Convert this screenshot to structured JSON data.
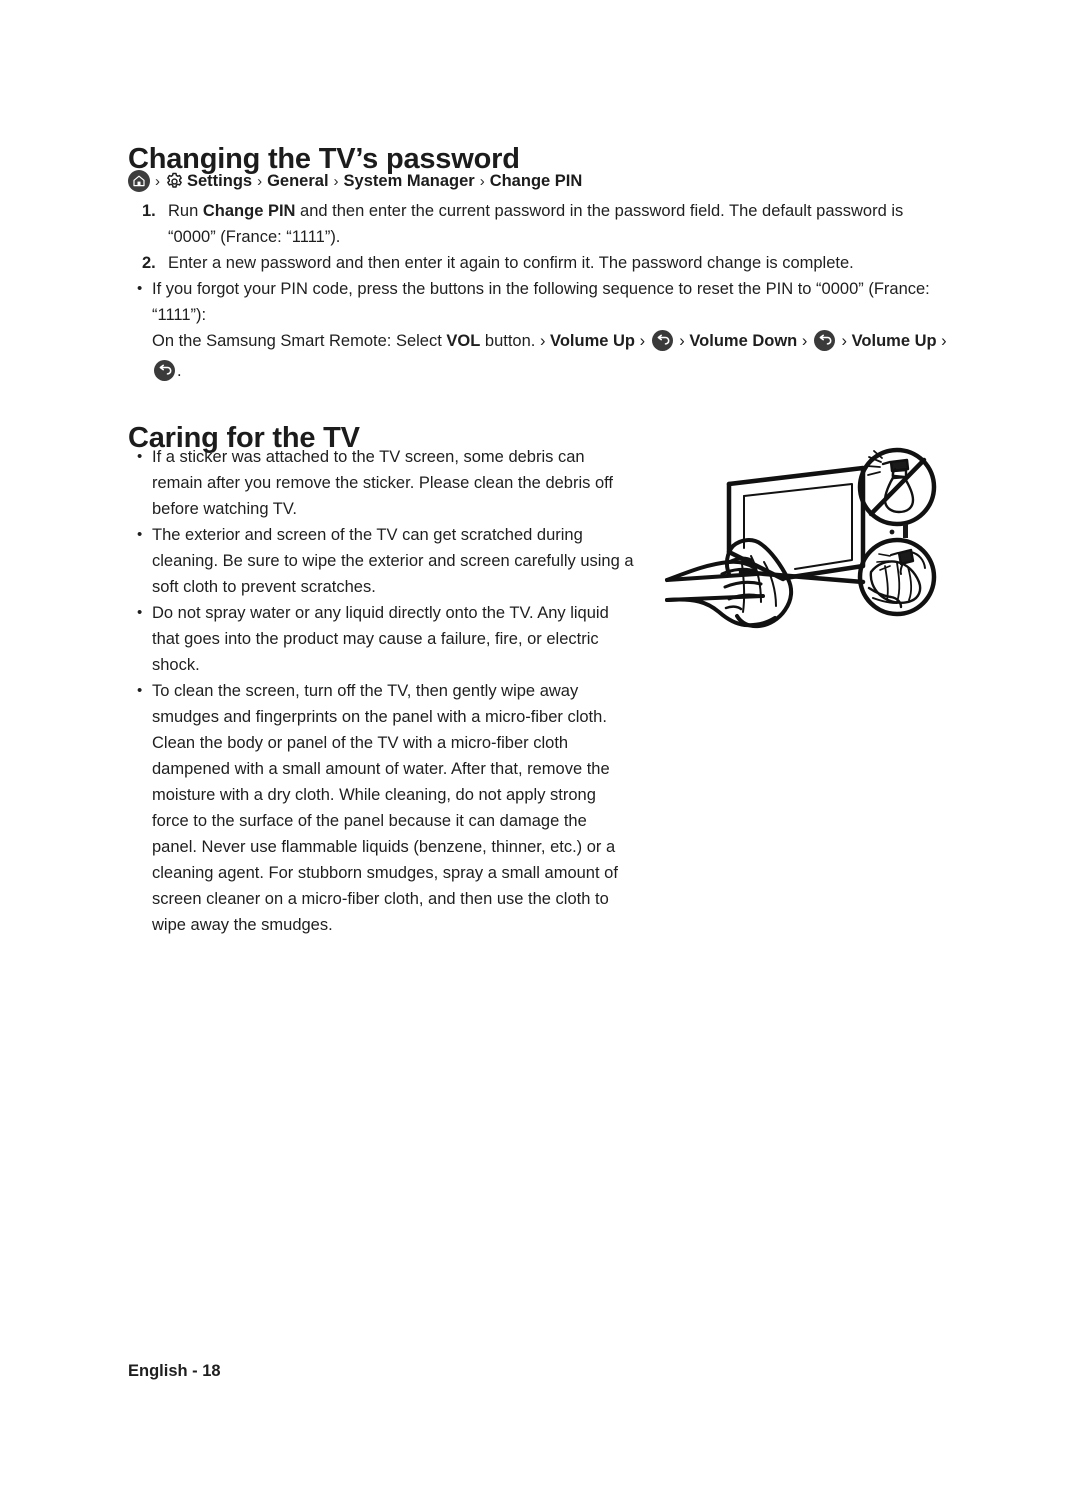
{
  "document": {
    "footer": "English - 18"
  },
  "sections": [
    {
      "id": "changing-password",
      "heading": "Changing the TV’s password",
      "breadcrumb": {
        "home_icon": "home-icon",
        "gear_icon": "gear-icon",
        "separator": "›",
        "items": [
          "Settings",
          "General",
          "System Manager",
          "Change PIN"
        ]
      },
      "steps": [
        {
          "number": "1.",
          "parts": [
            {
              "text": "Run ",
              "bold": false
            },
            {
              "text": "Change PIN",
              "bold": true
            },
            {
              "text": " and then enter the current password in the password field. The default password is “0000” (France: “1111”).",
              "bold": false
            }
          ]
        },
        {
          "number": "2.",
          "parts": [
            {
              "text": "Enter a new password and then enter it again to confirm it. The password change is complete.",
              "bold": false
            }
          ]
        }
      ],
      "note": {
        "bullet": "•",
        "text": "If you forgot your PIN code, press the buttons in the following sequence to reset the PIN to “0000” (France: “1111”):"
      },
      "remote_sequence": {
        "lead": "On the Samsung Smart Remote: Select ",
        "vol_label": "VOL",
        "after_vol": " button. ",
        "separator": "›",
        "volume_up": "Volume Up",
        "volume_down": "Volume Down",
        "return_icon": "return-icon",
        "trailing": "."
      }
    },
    {
      "id": "caring-for-tv",
      "heading": "Caring for the TV",
      "bullet": "•",
      "items": [
        "If a sticker was attached to the TV screen, some debris can remain after you remove the sticker. Please clean the debris off before watching TV.",
        "The exterior and screen of the TV can get scratched during cleaning. Be sure to wipe the exterior and screen carefully using a soft cloth to prevent scratches.",
        "Do not spray water or any liquid directly onto the TV. Any liquid that goes into the product may cause a failure, fire, or electric shock.",
        "To clean the screen, turn off the TV, then gently wipe away smudges and fingerprints on the panel with a micro-fiber cloth. Clean the body or panel of the TV with a micro-fiber cloth dampened with a small amount of water. After that, remove the moisture with a dry cloth. While cleaning, do not apply strong force to the surface of the panel because it can damage the panel. Never use flammable liquids (benzene, thinner, etc.) or a cleaning agent. For stubborn smudges, spray a small amount of screen cleaner on a micro-fiber cloth, and then use the cloth to wipe away the smudges."
      ],
      "illustration": {
        "name": "tv-cleaning-illustration",
        "description": "Hand wiping a TV screen with a cloth, with two circular insets: a crossed-out spray bottle spraying the screen, and a spray bottle spraying onto a cloth."
      }
    }
  ],
  "colors": {
    "text": "#1f1f1f",
    "icon_fill": "#3a3a3a",
    "line_art": "#1a1a1a"
  }
}
